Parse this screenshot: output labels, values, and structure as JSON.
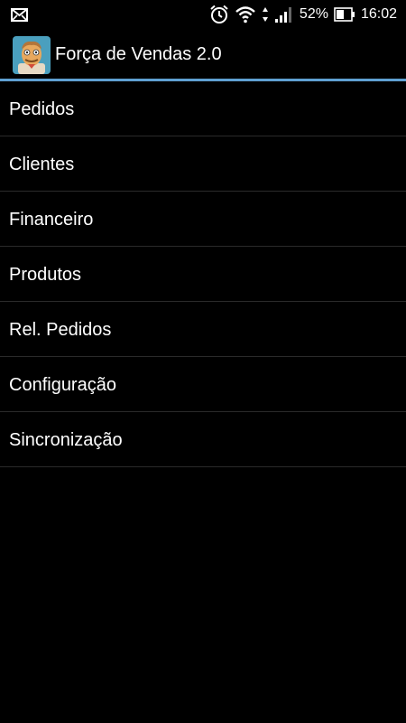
{
  "status_bar": {
    "battery_percent": "52%",
    "time": "16:02",
    "icons": [
      "mail-icon",
      "alarm-icon",
      "wifi-icon",
      "data-arrows-icon",
      "signal-icon",
      "battery-icon"
    ]
  },
  "action_bar": {
    "title": "Força de Vendas 2.0",
    "icon": "app-avatar-icon"
  },
  "colors": {
    "background": "#000000",
    "divider_accent": "#5fa0d2",
    "row_separator": "#2a2a2a",
    "text": "#ffffff"
  },
  "menu": {
    "items": [
      {
        "label": "Pedidos"
      },
      {
        "label": "Clientes"
      },
      {
        "label": "Financeiro"
      },
      {
        "label": "Produtos"
      },
      {
        "label": "Rel. Pedidos"
      },
      {
        "label": "Configuração"
      },
      {
        "label": "Sincronização"
      }
    ]
  }
}
